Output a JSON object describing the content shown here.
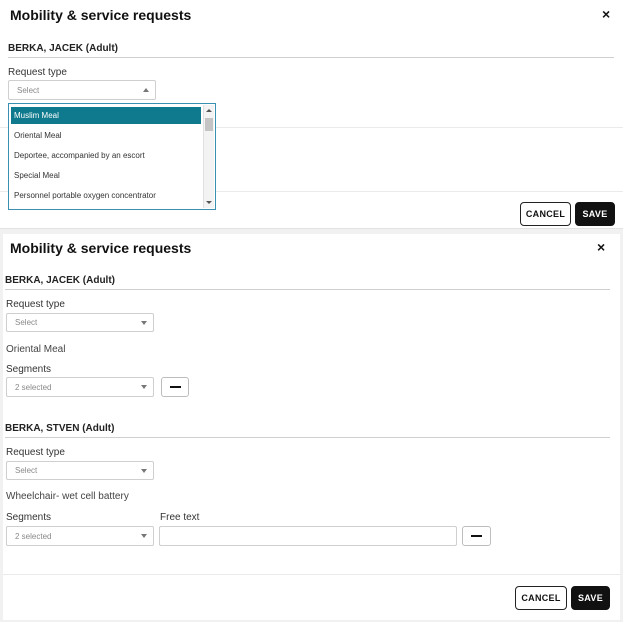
{
  "top_dialog": {
    "title": "Mobility & service requests",
    "close_glyph": "×",
    "passenger": "BERKA, JACEK (Adult)",
    "request_type_label": "Request type",
    "select_placeholder": "Select",
    "dropdown_options": [
      {
        "label": "Muslim Meal",
        "selected": true
      },
      {
        "label": "Oriental Meal",
        "selected": false
      },
      {
        "label": "Deportee, accompanied by an escort",
        "selected": false
      },
      {
        "label": "Special Meal",
        "selected": false
      },
      {
        "label": "Personnel portable oxygen concentrator",
        "selected": false
      }
    ],
    "cancel_label": "CANCEL",
    "save_label": "SAVE"
  },
  "bottom_dialog": {
    "title": "Mobility & service requests",
    "close_glyph": "×",
    "passengers": [
      {
        "name": "BERKA, JACEK (Adult)",
        "request_type_label": "Request type",
        "select_placeholder": "Select",
        "service": "Oriental Meal",
        "segments_label": "Segments",
        "segments_value": "2 selected"
      },
      {
        "name": "BERKA, STVEN (Adult)",
        "request_type_label": "Request type",
        "select_placeholder": "Select",
        "service": "Wheelchair- wet cell battery",
        "segments_label": "Segments",
        "segments_value": "2 selected",
        "free_text_label": "Free text",
        "free_text_value": ""
      }
    ],
    "cancel_label": "CANCEL",
    "save_label": "SAVE"
  },
  "colors": {
    "selected_option_bg": "#0f7a8d",
    "save_button_bg": "#111111",
    "dropdown_border": "#3b8fb0"
  },
  "icons": [
    "close-icon",
    "chevron-down-icon",
    "chevron-up-icon",
    "minus-icon"
  ]
}
